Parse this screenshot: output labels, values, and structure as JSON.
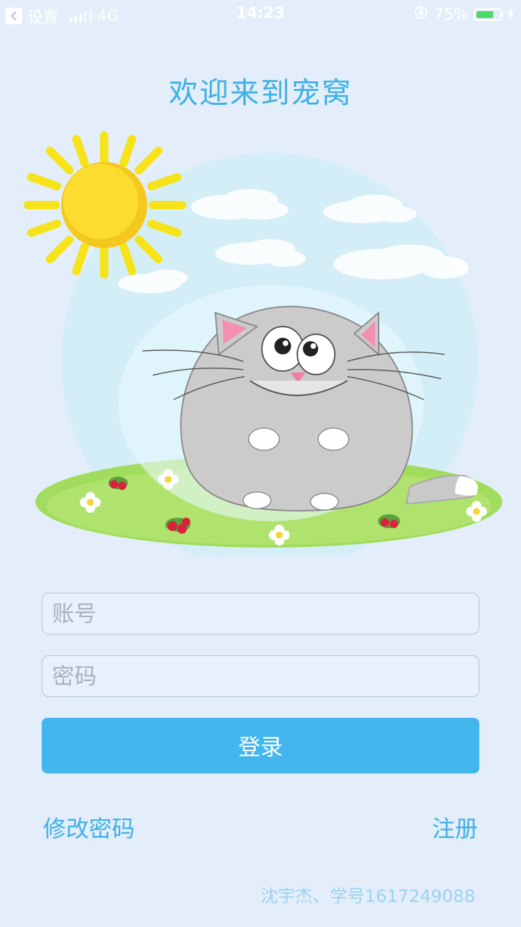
{
  "status_bar": {
    "back_app": "设置",
    "network": "4G",
    "time": "14:23",
    "battery": "75%",
    "battery_level": 0.75
  },
  "title": "欢迎来到宠窝",
  "form": {
    "account_placeholder": "账号",
    "password_placeholder": "密码",
    "login_label": "登录"
  },
  "links": {
    "change_password": "修改密码",
    "register": "注册"
  },
  "footer": "沈宇杰、学号1617249088",
  "colors": {
    "background": "#e3eefa",
    "accent": "#3fb0e6",
    "button": "#44b6ee",
    "battery_green": "#4cd964"
  }
}
